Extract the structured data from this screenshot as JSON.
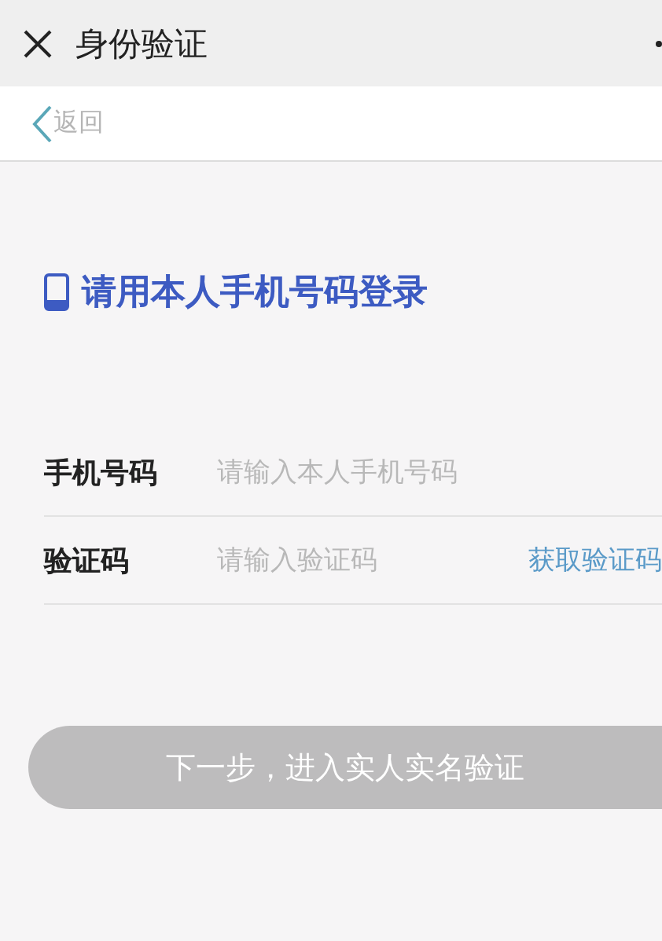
{
  "title_bar": {
    "title": "身份验证"
  },
  "nav_bar": {
    "back_label": "返回"
  },
  "heading": "请用本人手机号码登录",
  "fields": [
    {
      "label": "手机号码",
      "placeholder": "请输入本人手机号码"
    },
    {
      "label": "验证码",
      "placeholder": "请输入验证码",
      "action": "获取验证码"
    }
  ],
  "submit_button": {
    "label": "下一步，进入实人实名验证",
    "disabled": true
  }
}
